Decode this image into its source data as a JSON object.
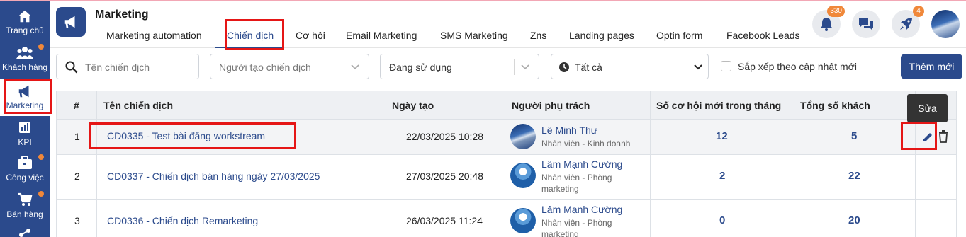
{
  "sidebar": {
    "items": [
      {
        "label": "Trang chủ",
        "icon": "home-icon"
      },
      {
        "label": "Khách hàng",
        "icon": "users-icon"
      },
      {
        "label": "Marketing",
        "icon": "megaphone-icon"
      },
      {
        "label": "KPI",
        "icon": "chart-icon"
      },
      {
        "label": "Công việc",
        "icon": "briefcase-icon"
      },
      {
        "label": "Bán hàng",
        "icon": "cart-icon"
      }
    ]
  },
  "header": {
    "title": "Marketing",
    "tabs": [
      {
        "label": "Marketing automation"
      },
      {
        "label": "Chiến dịch"
      },
      {
        "label": "Cơ hội"
      },
      {
        "label": "Email Marketing"
      },
      {
        "label": "SMS Marketing"
      },
      {
        "label": "Zns"
      },
      {
        "label": "Landing pages"
      },
      {
        "label": "Optin form"
      },
      {
        "label": "Facebook Leads"
      }
    ],
    "notification_count": "330",
    "rocket_count": "4"
  },
  "filters": {
    "search_placeholder": "Tên chiến dịch",
    "creator_placeholder": "Người tạo chiến dịch",
    "status_value": "Đang sử dụng",
    "time_value": "Tất cả",
    "sort_label": "Sắp xếp theo cập nhật mới",
    "add_button": "Thêm mới"
  },
  "table": {
    "headers": [
      "#",
      "Tên chiến dịch",
      "Ngày tạo",
      "Người phụ trách",
      "Số cơ hội mới trong tháng",
      "Tổng số khách"
    ],
    "rows": [
      {
        "idx": "1",
        "name": "CD0335 - Test bài đăng workstream",
        "date": "22/03/2025 10:28",
        "owner": "Lê Minh Thư",
        "role1": "Nhân viên - Kinh doanh",
        "role2": "",
        "opps": "12",
        "customers": "5"
      },
      {
        "idx": "2",
        "name": "CD0337 - Chiến dịch bán hàng ngày 27/03/2025",
        "date": "27/03/2025 20:48",
        "owner": "Lâm Mạnh Cường",
        "role1": "Nhân viên - Phòng",
        "role2": "marketing",
        "opps": "2",
        "customers": "22"
      },
      {
        "idx": "3",
        "name": "CD0336 - Chiến dịch Remarketing",
        "date": "26/03/2025 11:24",
        "owner": "Lâm Mạnh Cường",
        "role1": "Nhân viên - Phòng",
        "role2": "marketing",
        "opps": "0",
        "customers": "20"
      }
    ]
  },
  "tooltip": "Sửa",
  "colors": {
    "primary": "#2b4a8c",
    "accent": "#f0883a",
    "highlight": "#e51616"
  }
}
